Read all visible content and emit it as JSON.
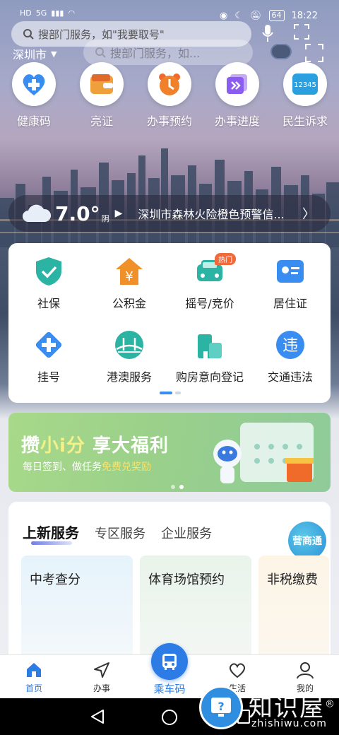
{
  "status": {
    "time": "18:22",
    "battery": "64",
    "network": "5G",
    "hd": "HD"
  },
  "search": {
    "placeholder": "搜部门服务，如\"我要取号\"",
    "ghost": "搜部门服务，如..."
  },
  "location": {
    "city": "深圳市"
  },
  "quick_entries": [
    {
      "label": "健康码",
      "icon": "health-code-icon",
      "color": "#3a8df0"
    },
    {
      "label": "亮证",
      "icon": "wallet-icon",
      "color": "#f08a2a"
    },
    {
      "label": "办事预约",
      "icon": "clock-icon",
      "color": "#f06a2a"
    },
    {
      "label": "办事进度",
      "icon": "progress-icon",
      "color": "#8a5cf0"
    },
    {
      "label": "民生诉求",
      "icon": "hotline-icon",
      "color": "#2aa0e0",
      "icon_text": "12345"
    }
  ],
  "weather": {
    "temp": "7.0°",
    "condition": "阴",
    "notice": "深圳市森林火险橙色预警信..."
  },
  "services": [
    {
      "label": "社保",
      "icon": "shield-check-icon"
    },
    {
      "label": "公积金",
      "icon": "house-yen-icon"
    },
    {
      "label": "摇号/竞价",
      "icon": "car-icon",
      "badge": "热门"
    },
    {
      "label": "居住证",
      "icon": "id-card-icon"
    },
    {
      "label": "挂号",
      "icon": "medical-cross-icon"
    },
    {
      "label": "港澳服务",
      "icon": "bridge-icon"
    },
    {
      "label": "购房意向登记",
      "icon": "building-icon"
    },
    {
      "label": "交通违法",
      "icon": "traffic-violation-icon",
      "icon_text": "违"
    }
  ],
  "banner": {
    "title_a": "攒",
    "title_hl": "小i分",
    "title_b": " 享大福利",
    "sub_a": "每日签到、做任务",
    "sub_hl": "免费兑奖励"
  },
  "tabs": [
    {
      "label": "上新服务",
      "active": true
    },
    {
      "label": "专区服务"
    },
    {
      "label": "企业服务"
    }
  ],
  "ysb_label": "营商通",
  "new_services": [
    {
      "label": "中考查分"
    },
    {
      "label": "体育场馆预约"
    },
    {
      "label": "非税缴费"
    }
  ],
  "bottom_nav": [
    {
      "label": "首页",
      "active": true
    },
    {
      "label": "办事"
    },
    {
      "label": "生活"
    },
    {
      "label": "我的"
    }
  ],
  "center_nav": {
    "label": "乘车码"
  },
  "watermark": {
    "text": "知识屋",
    "domain": "zhishiwu.com",
    "mark": "®"
  }
}
